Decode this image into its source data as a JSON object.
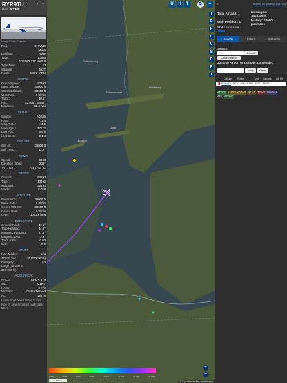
{
  "aircraft": {
    "callsign": "RYR9TU",
    "hex_label": "Hex:",
    "hex": "402368",
    "nav_prev": "‹",
    "nav_close": "×",
    "photo_caption": "Image © Stan Polanski"
  },
  "details": {
    "rows": [
      {
        "k": "Reg.:",
        "v": "9H-VUB"
      },
      {
        "k": "",
        "v": "Malta"
      },
      {
        "k": "DB flags:",
        "v": "none"
      },
      {
        "k": "Type:",
        "v": "B38M"
      },
      {
        "k": "",
        "v": "BOEING 737 MAX 8"
      },
      {
        "k": "Type Desc.:",
        "v": "L2J"
      },
      {
        "k": "Squawk:",
        "v": "5527"
      },
      {
        "k": "Route:",
        "v": "BCN - ARN"
      }
    ]
  },
  "sections": [
    {
      "title": "SPATIAL",
      "rows": [
        {
          "k": "Groundspeed:",
          "v": "523 kt"
        },
        {
          "k": "Baro. altitude:",
          "v": "35000 ft"
        },
        {
          "k": "WGS84 altitude:",
          "v": "35650 ft"
        },
        {
          "k": "Vert. Rate:",
          "v": "0 ft/min"
        },
        {
          "k": "Track:",
          "v": "40.1°"
        },
        {
          "k": "Pos.:",
          "v": "53.509°, 6.944°"
        },
        {
          "k": "Distance:",
          "v": "38.4 nmi"
        }
      ]
    },
    {
      "title": "SIGNAL",
      "rows": [
        {
          "k": "Source:",
          "v": "ADS-B"
        },
        {
          "k": "RSSI:",
          "v": "-11.4"
        },
        {
          "k": "Msg. Rate:",
          "v": "44.1"
        },
        {
          "k": "Messages:",
          "v": "37172"
        },
        {
          "k": "Last Pos.:",
          "v": "0.4 s"
        },
        {
          "k": "Last Seen:",
          "v": "0.1 s"
        }
      ]
    },
    {
      "title": "FMS SEL",
      "rows": [
        {
          "k": "Sel. Alt.:",
          "v": "35008 ft"
        },
        {
          "k": "Sel. Head.:",
          "v": "42.2°"
        }
      ]
    },
    {
      "title": "WIND",
      "rows": [
        {
          "k": "Speed:",
          "v": "96 kt"
        },
        {
          "k": "Direction (from):",
          "v": "208°"
        },
        {
          "k": "TAT / OAT:",
          "v": "-29 / -54 °C"
        }
      ]
    },
    {
      "title": "SPEED",
      "rows": [
        {
          "k": "Ground:",
          "v": "523 kt"
        },
        {
          "k": "True:",
          "v": "434 kt"
        },
        {
          "k": "Indicated:",
          "v": "254 kt"
        },
        {
          "k": "Mach:",
          "v": "0.752"
        }
      ]
    },
    {
      "title": "ALTITUDE",
      "rows": [
        {
          "k": "Barometric:",
          "v": "35000 ft"
        },
        {
          "k": "Baro. Rate:",
          "v": "0 ft/min"
        },
        {
          "k": "Geom. WGS84:",
          "v": "35650 ft"
        },
        {
          "k": "Geom. Rate:",
          "v": "0 ft/min"
        },
        {
          "k": "QNH:",
          "v": "1013.6 hPa"
        }
      ]
    },
    {
      "title": "DIRECTION",
      "rows": [
        {
          "k": "Ground Track:",
          "v": "40.1°"
        },
        {
          "k": "True Heading:",
          "v": "44.5°"
        },
        {
          "k": "Magnetic Heading:",
          "v": "41.3°"
        },
        {
          "k": "Magnetic Decl.:",
          "v": "3.3°"
        },
        {
          "k": "Track Rate:",
          "v": "-0.03"
        },
        {
          "k": "Roll:",
          "v": "-0.5"
        }
      ]
    },
    {
      "title": "STUFF",
      "rows": [
        {
          "k": "Nav. Modes:",
          "v": "n/a"
        },
        {
          "k": "ADS-B Ver.:",
          "v": "v2 (DO-260B)"
        },
        {
          "k": "Category:",
          "v": "A3"
        },
        {
          "k": "Large (75 000 to",
          "v": ""
        },
        {
          "k": "300 000 lb)",
          "v": ""
        }
      ]
    },
    {
      "title": "ACCURACY",
      "rows": [
        {
          "k": "NACp:",
          "v": "EPU < 3 m"
        },
        {
          "k": "SIL:",
          "v": "≤ 1e-7"
        },
        {
          "k": "NACv:",
          "v": "< 3 m/s"
        },
        {
          "k": "NICbaro:",
          "v": "cross-checked"
        },
        {
          "k": "Rc:",
          "v": "186 m"
        }
      ]
    }
  ],
  "footnote": "Learn more about Mode S data type by hovering over each data label.",
  "map": {
    "top_buttons": [
      "U",
      "H",
      "T"
    ],
    "side_buttons": [
      "I",
      "O",
      "K",
      "L",
      "V",
      "M",
      "P",
      "R",
      "I"
    ],
    "place_labels": [
      "Rottumeroog",
      "Rottumerplaat",
      "Borkum",
      "Juist",
      "Norderney"
    ],
    "legend_ticks": [
      "2000",
      "4000",
      "6000",
      "8000",
      "10 000",
      "20 000",
      "30 000",
      "40 000+"
    ],
    "scale": "5 km",
    "attribution": "© OpenStreetMap contributors.",
    "colors": {
      "sea": "#37474f",
      "land": "#4a5a3a",
      "track": "#a040ff",
      "selected": "#a040ff"
    }
  },
  "right": {
    "link": "tar1090 on github (3.14.1700)",
    "total_label": "Total Aircraft: 1",
    "pos_label": "With Position: 1",
    "messages_label": "Messages:",
    "messages_value": "1449.4/sec",
    "history_label": "History: 27060",
    "history_value": "positions",
    "stats_label": "Stats available",
    "tabs": [
      "Search",
      "Filters",
      "Columns"
    ],
    "search_label": "Search:",
    "search_button": "Search",
    "clear_search": "Clear Search",
    "jump_label": "Jump to Airport or Latitude, Longitude:",
    "jump_button": "Jump",
    "clear_button": "Clear",
    "sources": [
      {
        "label": "ADS-B",
        "color": "#2a6f3a"
      },
      {
        "label": "UAT / ADS-R",
        "color": "#6a5a20"
      },
      {
        "label": "MLAT",
        "color": "#5a4a1e"
      },
      {
        "label": "TIS-B",
        "color": "#6e2a2a"
      },
      {
        "label": "Mode-S",
        "color": "#3a3a6a"
      },
      {
        "label": "AIS",
        "color": "#3a3a3a"
      },
      {
        "label": "ADS-C",
        "color": "#2e5a3a"
      }
    ],
    "table_headers": [
      "Callsign",
      "Route",
      "Type",
      "Squawk",
      "Alt. (ft)"
    ],
    "table_row": {
      "flag": "MT",
      "callsign": "RYR9TU",
      "route": "BCN - ARN",
      "type": "B38M",
      "squawk": "5527",
      "alt": "35000"
    }
  }
}
